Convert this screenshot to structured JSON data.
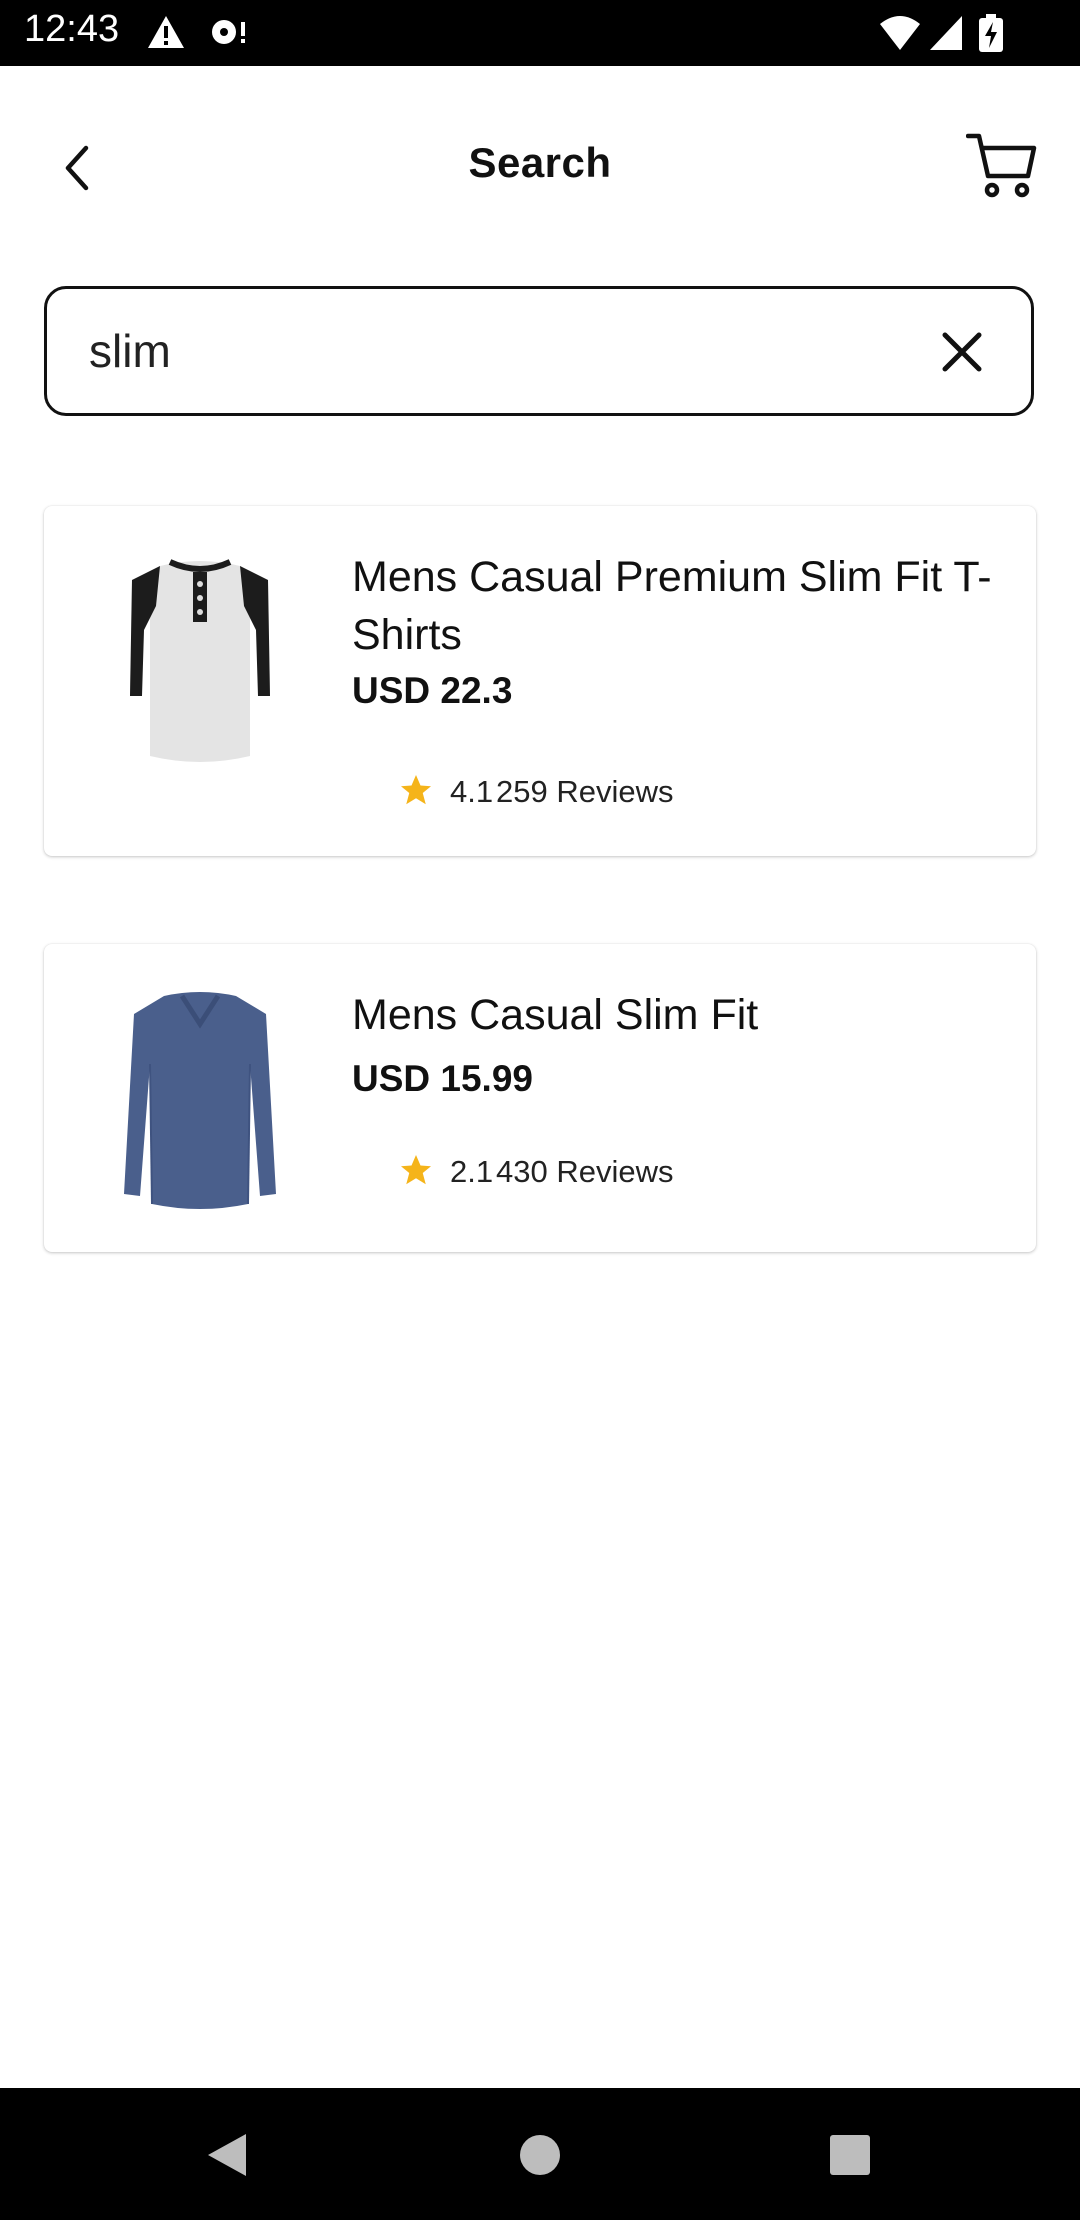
{
  "status_bar": {
    "time": "12:43",
    "icons": [
      "alert-icon",
      "cast-icon",
      "wifi-icon",
      "signal-icon",
      "battery-charging-icon"
    ]
  },
  "header": {
    "title": "Search",
    "back_icon": "chevron-left-icon",
    "cart_icon": "cart-icon"
  },
  "search": {
    "value": "slim",
    "clear_icon": "close-icon"
  },
  "results": [
    {
      "title": "Mens Casual Premium Slim Fit T-Shirts",
      "price": "USD 22.3",
      "rating": "4.1",
      "reviews": "259 Reviews",
      "image": "raglan-henley-shirt"
    },
    {
      "title": "Mens Casual Slim Fit",
      "price": "USD 15.99",
      "rating": "2.1",
      "reviews": "430 Reviews",
      "image": "blue-long-sleeve-shirt"
    }
  ],
  "colors": {
    "star": "#F5B41A",
    "text": "#111111",
    "statusbar_bg": "#000000"
  },
  "nav_bar": {
    "icons": [
      "back-triangle-icon",
      "home-circle-icon",
      "recents-square-icon"
    ]
  }
}
